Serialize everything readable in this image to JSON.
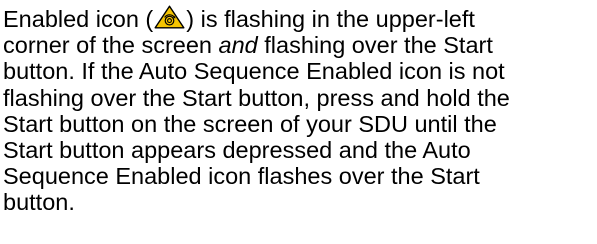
{
  "document": {
    "line1": {
      "before_icon": "Enabled icon (",
      "after_icon": ") is flashing in the upper-left"
    },
    "line2": "corner of the screen",
    "line2_emphasis": "and",
    "line2_end": "flashing over the Start",
    "line3": "button. If the Auto Sequence Enabled icon is not",
    "line4": "flashing over the Start button, press and hold the",
    "line5": "Start button on the screen of your SDU until the",
    "line6": "Start button appears depressed and the Auto",
    "line7": "Sequence Enabled icon flashes over the Start",
    "line8": "button."
  },
  "icon": {
    "name": "auto-sequence-enabled-warning-icon",
    "fill_color": "#f5c400",
    "stroke_color": "#000000"
  }
}
